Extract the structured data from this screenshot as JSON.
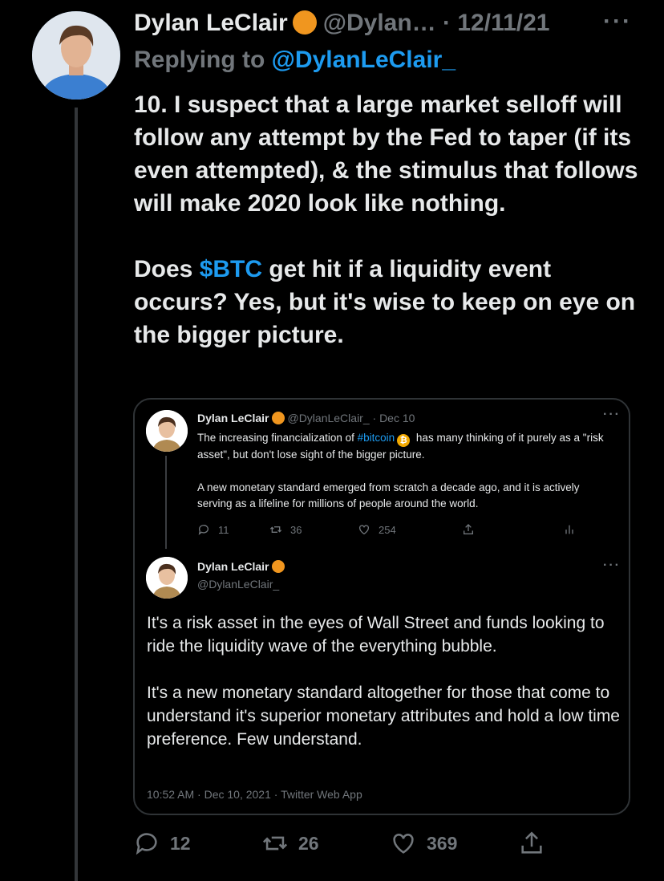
{
  "tweet": {
    "author_name": "Dylan LeClair",
    "handle": "@Dylan…",
    "separator": " · ",
    "date": "12/11/21",
    "more": "···",
    "reply_prefix": "Replying to ",
    "reply_to": "@DylanLeClair_",
    "para1": "10. I suspect that a large market selloff will follow any attempt by the Fed to taper (if its even attempted), & the stimulus that follows will make 2020 look like nothing.",
    "para2_prefix": "Does ",
    "para2_cashtag": "$BTC",
    "para2_suffix": " get hit if a liquidity event occurs? Yes, but it's wise to keep on eye on the bigger picture.",
    "stats": {
      "replies": "12",
      "retweets": "26",
      "likes": "369"
    },
    "badge_color": "#f0961f",
    "link_color": "#1d9bf0"
  },
  "quote": {
    "first": {
      "name": "Dylan LeClair",
      "handle_date": "@DylanLeClair_ · Dec 10",
      "more": "···",
      "text1_prefix": "The increasing financialization of ",
      "hashtag": "#bitcoin",
      "btc_glyph": "₿",
      "text1_suffix": " has many thinking of it purely as a \"risk asset\", but don't lose sight of the bigger picture.",
      "text2": "A new monetary standard emerged from scratch a decade ago, and it is actively serving as a lifeline for millions of people around the world.",
      "stats": {
        "replies": "11",
        "retweets": "36",
        "likes": "254"
      }
    },
    "second": {
      "name": "Dylan LeClair",
      "handle": "@DylanLeClair_",
      "more": "···",
      "para1": "It's a risk asset in the eyes of Wall Street and funds looking to ride the liquidity wave of the everything bubble.",
      "para2": "It's a new monetary standard altogether for those that come to understand it's superior monetary attributes and hold a low time preference. Few understand.",
      "timestamp": "10:52 AM · Dec 10, 2021 · Twitter Web App"
    }
  },
  "icons": {
    "reply": "reply-icon",
    "retweet": "retweet-icon",
    "like": "heart-icon",
    "share": "share-icon",
    "analytics": "analytics-icon",
    "verified": "orange-badge-icon",
    "bitcoin": "bitcoin-icon"
  }
}
